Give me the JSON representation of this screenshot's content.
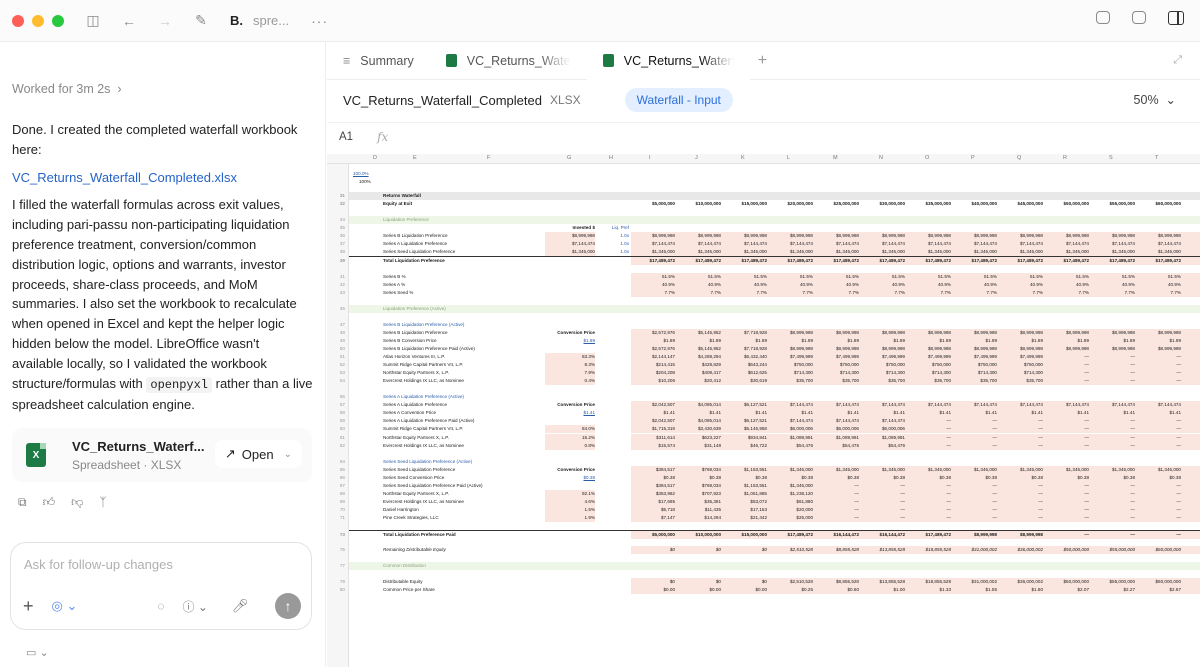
{
  "window": {
    "title": "B.",
    "subtitle": "spre...",
    "more": "···"
  },
  "chat": {
    "worked": "Worked for 3m 2s",
    "message_intro": "Done. I created the completed waterfall workbook here:",
    "file_link": "VC_Returns_Waterfall_Completed.xlsx",
    "message_body_1": "I filled the waterfall formulas across exit values, including pari-passu non-participating liquidation preference treatment, conversion/common distribution logic, options and warrants, investor proceeds, share-class proceeds, and MoM summaries. I also set the workbook to recalculate when opened in Excel and kept the helper logic hidden below the model. LibreOffice wasn't available locally, so I validated the workbook structure/formulas with",
    "code_term": "openpyxl",
    "message_body_2": "rather than a live spreadsheet calculation engine.",
    "file_card": {
      "name": "VC_Returns_Waterf...",
      "type": "Spreadsheet · XLSX",
      "open_label": "Open"
    },
    "composer_placeholder": "Ask for follow-up changes"
  },
  "viewer": {
    "tabs": [
      {
        "label": "Summary"
      },
      {
        "label": "VC_Returns_Waterf"
      },
      {
        "label": "VC_Returns_Waterf"
      }
    ],
    "doc_name": "VC_Returns_Waterfall_Completed",
    "doc_type": "XLSX",
    "sheet_name": "Waterfall - Input",
    "zoom": "50%",
    "cell_ref": "A1",
    "fx": "fx",
    "columns": [
      "D",
      "E",
      "F",
      "G",
      "H",
      "I",
      "J",
      "K",
      "L",
      "M",
      "N",
      "O",
      "P",
      "Q",
      "R",
      "S",
      "T"
    ]
  },
  "sheet": {
    "top_pct": [
      "100.0%",
      "100%"
    ],
    "rows": [
      {
        "n": "31",
        "type": "hdr",
        "label": "Returns Waterfall",
        "cells": []
      },
      {
        "n": "32",
        "type": "bold",
        "label": "Equity at Exit",
        "cells": [
          "$5,000,000",
          "$10,000,000",
          "$15,000,000",
          "$20,000,000",
          "$25,000,000",
          "$30,000,000",
          "$35,000,000",
          "$40,000,000",
          "$45,000,000",
          "$50,000,000",
          "$55,000,000",
          "$60,000,000"
        ]
      },
      {
        "n": "34",
        "type": "section",
        "label": "Liquidation Preference",
        "cells": []
      },
      {
        "n": "35",
        "type": "plain",
        "label": "",
        "g": "Invested $",
        "h": "Liq. Pref",
        "cells": []
      },
      {
        "n": "36",
        "type": "plain",
        "label": "Series B Liquidation Preference",
        "g": "$8,999,998",
        "h": "1.0x",
        "cells": [
          "$8,999,998",
          "$8,999,998",
          "$8,999,998",
          "$8,999,998",
          "$8,999,998",
          "$8,999,998",
          "$8,999,998",
          "$8,999,998",
          "$8,999,998",
          "$8,999,998",
          "$8,999,998",
          "$8,999,998"
        ]
      },
      {
        "n": "37",
        "type": "plain",
        "label": "Series A Liquidation Preference",
        "g": "$7,144,474",
        "h": "1.0x",
        "cells": [
          "$7,144,474",
          "$7,144,474",
          "$7,144,474",
          "$7,144,474",
          "$7,144,474",
          "$7,144,474",
          "$7,144,474",
          "$7,144,474",
          "$7,144,474",
          "$7,144,474",
          "$7,144,474",
          "$7,144,474"
        ]
      },
      {
        "n": "38",
        "type": "plain",
        "label": "Series Seed Liquidation Preference",
        "g": "$1,345,000",
        "h": "1.0x",
        "cells": [
          "$1,345,000",
          "$1,345,000",
          "$1,345,000",
          "$1,345,000",
          "$1,345,000",
          "$1,345,000",
          "$1,345,000",
          "$1,345,000",
          "$1,345,000",
          "$1,345,000",
          "$1,345,000",
          "$1,345,000"
        ]
      },
      {
        "n": "39",
        "type": "total",
        "label": "Total Liquidation Preference",
        "cells": [
          "$17,489,472",
          "$17,489,472",
          "$17,489,472",
          "$17,489,472",
          "$17,489,472",
          "$17,489,472",
          "$17,489,472",
          "$17,489,472",
          "$17,489,472",
          "$17,489,472",
          "$17,489,472",
          "$17,489,472"
        ]
      },
      {
        "n": "41",
        "type": "plain",
        "label": "Series B %",
        "cells": [
          "51.5%",
          "51.5%",
          "51.5%",
          "51.5%",
          "51.5%",
          "51.5%",
          "51.5%",
          "51.5%",
          "51.5%",
          "51.5%",
          "51.5%",
          "51.5%"
        ]
      },
      {
        "n": "42",
        "type": "plain",
        "label": "Series A %",
        "cells": [
          "40.9%",
          "40.9%",
          "40.9%",
          "40.9%",
          "40.9%",
          "40.9%",
          "40.9%",
          "40.9%",
          "40.9%",
          "40.9%",
          "40.9%",
          "40.9%"
        ]
      },
      {
        "n": "43",
        "type": "plain",
        "label": "Series Seed %",
        "cells": [
          "7.7%",
          "7.7%",
          "7.7%",
          "7.7%",
          "7.7%",
          "7.7%",
          "7.7%",
          "7.7%",
          "7.7%",
          "7.7%",
          "7.7%",
          "7.7%"
        ]
      },
      {
        "n": "45",
        "type": "section",
        "label": "Liquidation Preference (Active)",
        "cells": []
      },
      {
        "n": "47",
        "type": "bluelbl",
        "label": "Series B Liquidation Preference (Active)",
        "cells": []
      },
      {
        "n": "48",
        "type": "plain",
        "label": "Series B Liquidation Preference",
        "g": "Conversion Price",
        "cells": [
          "$2,572,976",
          "$5,145,952",
          "$7,718,928",
          "$8,999,998",
          "$8,999,998",
          "$8,999,998",
          "$8,999,998",
          "$8,999,998",
          "$8,999,998",
          "$8,999,998",
          "$8,999,998",
          "$8,999,998"
        ]
      },
      {
        "n": "49",
        "type": "plain",
        "label": "Series B Conversion Price",
        "g": "$1.89",
        "cells": [
          "$1.89",
          "$1.89",
          "$1.89",
          "$1.89",
          "$1.89",
          "$1.89",
          "$1.89",
          "$1.89",
          "$1.89",
          "$1.89",
          "$1.89",
          "$1.89"
        ]
      },
      {
        "n": "50",
        "type": "plain",
        "label": "Series B Liquidation Preference Paid (Active)",
        "cells": [
          "$2,572,976",
          "$5,145,952",
          "$7,718,928",
          "$8,999,998",
          "$8,999,998",
          "$8,999,998",
          "$8,999,998",
          "$8,999,998",
          "$8,999,998",
          "$8,999,998",
          "$8,999,998",
          "$8,999,998"
        ]
      },
      {
        "n": "51",
        "type": "plain",
        "label": "Atlas Horizon Ventures III, L.P.",
        "g": "83.3%",
        "cells": [
          "$2,144,147",
          "$4,288,294",
          "$6,432,440",
          "$7,499,999",
          "$7,499,999",
          "$7,499,999",
          "$7,499,999",
          "$7,499,999",
          "$7,499,999",
          "—",
          "—",
          "—"
        ]
      },
      {
        "n": "52",
        "type": "plain",
        "label": "Summit Ridge Capital Partners VII, L.P.",
        "g": "8.3%",
        "cells": [
          "$214,415",
          "$428,829",
          "$643,244",
          "$750,000",
          "$750,000",
          "$750,000",
          "$750,000",
          "$750,000",
          "$750,000",
          "—",
          "—",
          "—"
        ]
      },
      {
        "n": "53",
        "type": "plain",
        "label": "Northstar Equity Partners X, L.P.",
        "g": "7.9%",
        "cells": [
          "$204,208",
          "$408,417",
          "$612,625",
          "$714,300",
          "$714,300",
          "$714,300",
          "$714,300",
          "$714,300",
          "$714,300",
          "—",
          "—",
          "—"
        ]
      },
      {
        "n": "54",
        "type": "plain",
        "label": "Evercrest Holdings IX LLC, as Nominee",
        "g": "0.4%",
        "cells": [
          "$10,206",
          "$20,412",
          "$30,619",
          "$35,700",
          "$35,700",
          "$35,700",
          "$35,700",
          "$35,700",
          "$35,700",
          "—",
          "—",
          "—"
        ]
      },
      {
        "n": "56",
        "type": "bluelbl",
        "label": "Series A Liquidation Preference (Active)",
        "cells": []
      },
      {
        "n": "57",
        "type": "plain",
        "label": "Series A Liquidation Preference",
        "g": "Conversion Price",
        "cells": [
          "$2,042,507",
          "$4,085,014",
          "$6,127,521",
          "$7,144,474",
          "$7,144,474",
          "$7,144,474",
          "$7,144,474",
          "$7,144,474",
          "$7,144,474",
          "$7,144,474",
          "$7,144,474",
          "$7,144,474"
        ]
      },
      {
        "n": "58",
        "type": "plain",
        "label": "Series A Conversion Price",
        "g": "$1.41",
        "cells": [
          "$1.41",
          "$1.41",
          "$1.41",
          "$1.41",
          "$1.41",
          "$1.41",
          "$1.41",
          "$1.41",
          "$1.41",
          "$1.41",
          "$1.41",
          "$1.41"
        ]
      },
      {
        "n": "59",
        "type": "plain",
        "label": "Series A Liquidation Preference Paid (Active)",
        "cells": [
          "$2,042,507",
          "$4,085,014",
          "$6,127,521",
          "$7,144,474",
          "$7,144,474",
          "$7,144,474",
          "—",
          "—",
          "—",
          "—",
          "—",
          "—"
        ]
      },
      {
        "n": "60",
        "type": "plain",
        "label": "Summit Ridge Capital Partners VII, L.P.",
        "g": "84.0%",
        "cells": [
          "$1,715,319",
          "$3,430,639",
          "$5,145,958",
          "$6,000,006",
          "$6,000,006",
          "$6,000,006",
          "—",
          "—",
          "—",
          "—",
          "—",
          "—"
        ]
      },
      {
        "n": "61",
        "type": "plain",
        "label": "Northstar Equity Partners X, L.P.",
        "g": "15.2%",
        "cells": [
          "$311,614",
          "$623,227",
          "$934,841",
          "$1,089,991",
          "$1,089,991",
          "$1,089,991",
          "—",
          "—",
          "—",
          "—",
          "—",
          "—"
        ]
      },
      {
        "n": "62",
        "type": "plain",
        "label": "Evercrest Holdings IX LLC, as Nominee",
        "g": "0.8%",
        "cells": [
          "$15,574",
          "$31,148",
          "$46,722",
          "$54,476",
          "$54,476",
          "$54,476",
          "—",
          "—",
          "—",
          "—",
          "—",
          "—"
        ]
      },
      {
        "n": "64",
        "type": "bluelbl",
        "label": "Series Seed Liquidation Preference (Active)",
        "cells": []
      },
      {
        "n": "65",
        "type": "plain",
        "label": "Series Seed Liquidation Preference",
        "g": "Conversion Price",
        "cells": [
          "$384,517",
          "$769,034",
          "$1,153,551",
          "$1,345,000",
          "$1,345,000",
          "$1,345,000",
          "$1,345,000",
          "$1,345,000",
          "$1,345,000",
          "$1,345,000",
          "$1,345,000",
          "$1,345,000"
        ]
      },
      {
        "n": "66",
        "type": "plain",
        "label": "Series Seed Conversion Price",
        "g": "$0.38",
        "cells": [
          "$0.38",
          "$0.38",
          "$0.38",
          "$0.38",
          "$0.38",
          "$0.38",
          "$0.38",
          "$0.38",
          "$0.38",
          "$0.38",
          "$0.38",
          "$0.38"
        ]
      },
      {
        "n": "67",
        "type": "plain",
        "label": "Series Seed Liquidation Preference Paid (Active)",
        "cells": [
          "$384,517",
          "$769,034",
          "$1,153,551",
          "$1,345,000",
          "—",
          "—",
          "—",
          "—",
          "—",
          "—",
          "—",
          "—"
        ]
      },
      {
        "n": "68",
        "type": "plain",
        "label": "Northstar Equity Partners X, L.P.",
        "g": "92.1%",
        "cells": [
          "$353,962",
          "$707,923",
          "$1,061,885",
          "$1,238,120",
          "—",
          "—",
          "—",
          "—",
          "—",
          "—",
          "—",
          "—"
        ]
      },
      {
        "n": "69",
        "type": "plain",
        "label": "Evercrest Holdings IX LLC, as Nominee",
        "g": "4.6%",
        "cells": [
          "$17,695",
          "$35,381",
          "$53,072",
          "$61,880",
          "—",
          "—",
          "—",
          "—",
          "—",
          "—",
          "—",
          "—"
        ]
      },
      {
        "n": "70",
        "type": "plain",
        "label": "Daniel Harrington",
        "g": "1.5%",
        "cells": [
          "$5,718",
          "$11,435",
          "$17,153",
          "$20,000",
          "—",
          "—",
          "—",
          "—",
          "—",
          "—",
          "—",
          "—"
        ]
      },
      {
        "n": "71",
        "type": "plain",
        "label": "Pine Creek Strategies, LLC",
        "g": "1.9%",
        "cells": [
          "$7,147",
          "$14,294",
          "$21,442",
          "$25,000",
          "—",
          "—",
          "—",
          "—",
          "—",
          "—",
          "—",
          "—"
        ]
      },
      {
        "n": "73",
        "type": "total",
        "label": "Total Liquidation Preference Paid",
        "cells": [
          "$5,000,000",
          "$10,000,000",
          "$15,000,000",
          "$17,489,472",
          "$16,144,472",
          "$16,144,472",
          "$17,489,472",
          "$8,999,998",
          "$8,999,998",
          "—",
          "—",
          "—"
        ]
      },
      {
        "n": "75",
        "type": "ital",
        "label": "Remaining Distributable Equity",
        "cells": [
          "$0",
          "$0",
          "$0",
          "$2,510,528",
          "$8,855,528",
          "$13,855,528",
          "$18,855,528",
          "$31,000,002",
          "$36,000,002",
          "$50,000,000",
          "$55,000,000",
          "$60,000,000"
        ]
      },
      {
        "n": "77",
        "type": "section",
        "label": "Common Distribution",
        "cells": []
      },
      {
        "n": "79",
        "type": "plain",
        "label": "Distributable Equity",
        "cells": [
          "$0",
          "$0",
          "$0",
          "$2,510,528",
          "$8,855,528",
          "$13,855,528",
          "$18,855,528",
          "$31,000,002",
          "$36,000,002",
          "$50,000,000",
          "$55,000,000",
          "$60,000,000"
        ]
      },
      {
        "n": "80",
        "type": "plain",
        "label": "Common Price per Share",
        "cells": [
          "$0.00",
          "$0.00",
          "$0.00",
          "$0.25",
          "$0.60",
          "$1.00",
          "$1.33",
          "$1.55",
          "$1.80",
          "$2.07",
          "$2.27",
          "$2.67"
        ]
      }
    ]
  }
}
